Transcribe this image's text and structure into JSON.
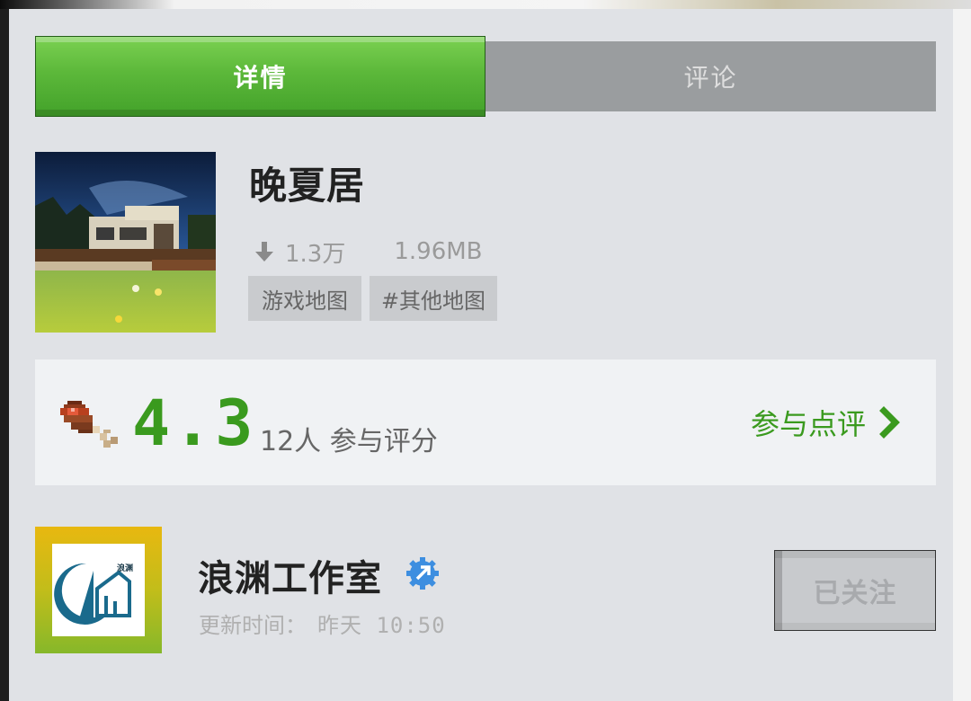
{
  "tabs": {
    "details": "详情",
    "comments": "评论"
  },
  "map": {
    "title": "晚夏居",
    "downloads": "1.3万",
    "size": "1.96MB",
    "tags": [
      "游戏地图",
      "#其他地图"
    ]
  },
  "rating": {
    "score": "4.3",
    "count_text": "12人 参与评分",
    "review_link": "参与点评"
  },
  "author": {
    "name": "浪渊工作室",
    "update_label": "更新时间：",
    "update_value": "昨天 10:50",
    "follow_label": "已关注",
    "logo_text": "浪渊"
  },
  "colors": {
    "accent_green": "#3a9a1e",
    "tab_active": "#5cb83a",
    "tab_inactive": "#9a9d9f",
    "panel_bg": "#e0e2e6",
    "verify_blue": "#3d8ee0"
  }
}
